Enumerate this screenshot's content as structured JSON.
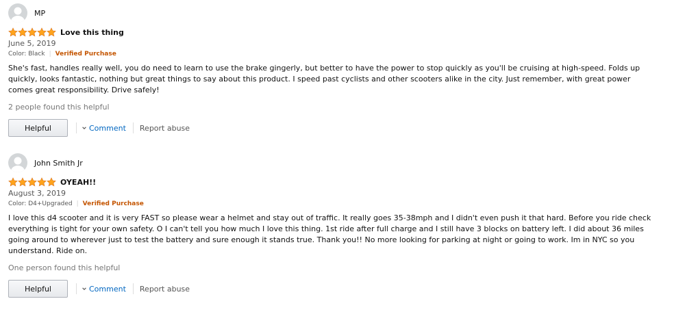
{
  "reviews": [
    {
      "profile_name": "MP",
      "rating": 5,
      "title": "Love this thing",
      "date": "June 5, 2019",
      "variant": "Color: Black",
      "verified": "Verified Purchase",
      "body": "She's fast, handles really well, you do need to learn to use the brake gingerly, but better to have the power to stop quickly as you'll be cruising at high-speed. Folds up quickly, looks fantastic, nothing but great things to say about this product. I speed past cyclists and other scooters alike in the city. Just remember, with great power comes great responsibility. Drive safely!",
      "helpful_count": "2 people found this helpful",
      "helpful_label": "Helpful",
      "comment_label": "Comment",
      "report_label": "Report abuse"
    },
    {
      "profile_name": "John Smith Jr",
      "rating": 5,
      "title": "OYEAH!!",
      "date": "August 3, 2019",
      "variant": "Color: D4+Upgraded",
      "verified": "Verified Purchase",
      "body": "I love this d4 scooter and it is very FAST so please wear a helmet and stay out of traffic. It really goes 35-38mph and I didn't even push it that hard. Before you ride check everything is tight for your own safety. O I can't tell you how much I love this thing. 1st ride after full charge and I still have 3 blocks on battery left. I did about 36 miles going around to wherever just to test the battery and sure enough it stands true. Thank you!! No more looking for parking at night or going to work. Im in NYC so you understand. Ride on.",
      "helpful_count": "One person found this helpful",
      "helpful_label": "Helpful",
      "comment_label": "Comment",
      "report_label": "Report abuse"
    }
  ],
  "colors": {
    "star": "#ffa41c",
    "star_outline": "#de7921",
    "verified": "#c45500",
    "link": "#0066c0"
  },
  "icons": {
    "avatar": "user-silhouette-icon",
    "star": "star-icon",
    "chevron": "chevron-down-icon"
  }
}
